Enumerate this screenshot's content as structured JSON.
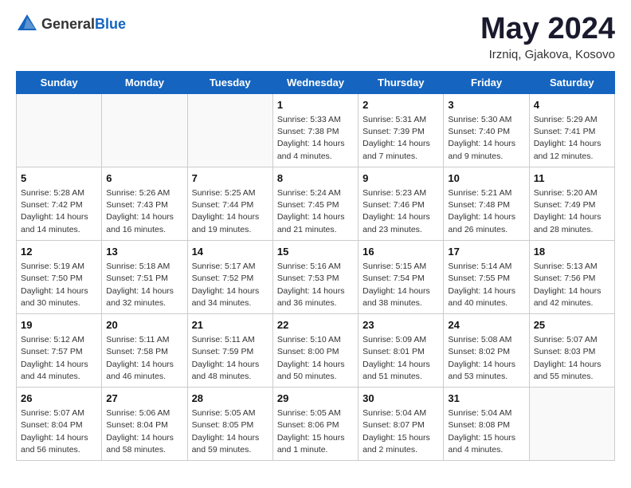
{
  "header": {
    "logo_general": "General",
    "logo_blue": "Blue",
    "month_title": "May 2024",
    "location": "Irzniq, Gjakova, Kosovo"
  },
  "weekdays": [
    "Sunday",
    "Monday",
    "Tuesday",
    "Wednesday",
    "Thursday",
    "Friday",
    "Saturday"
  ],
  "weeks": [
    [
      {
        "day": "",
        "info": ""
      },
      {
        "day": "",
        "info": ""
      },
      {
        "day": "",
        "info": ""
      },
      {
        "day": "1",
        "info": "Sunrise: 5:33 AM\nSunset: 7:38 PM\nDaylight: 14 hours\nand 4 minutes."
      },
      {
        "day": "2",
        "info": "Sunrise: 5:31 AM\nSunset: 7:39 PM\nDaylight: 14 hours\nand 7 minutes."
      },
      {
        "day": "3",
        "info": "Sunrise: 5:30 AM\nSunset: 7:40 PM\nDaylight: 14 hours\nand 9 minutes."
      },
      {
        "day": "4",
        "info": "Sunrise: 5:29 AM\nSunset: 7:41 PM\nDaylight: 14 hours\nand 12 minutes."
      }
    ],
    [
      {
        "day": "5",
        "info": "Sunrise: 5:28 AM\nSunset: 7:42 PM\nDaylight: 14 hours\nand 14 minutes."
      },
      {
        "day": "6",
        "info": "Sunrise: 5:26 AM\nSunset: 7:43 PM\nDaylight: 14 hours\nand 16 minutes."
      },
      {
        "day": "7",
        "info": "Sunrise: 5:25 AM\nSunset: 7:44 PM\nDaylight: 14 hours\nand 19 minutes."
      },
      {
        "day": "8",
        "info": "Sunrise: 5:24 AM\nSunset: 7:45 PM\nDaylight: 14 hours\nand 21 minutes."
      },
      {
        "day": "9",
        "info": "Sunrise: 5:23 AM\nSunset: 7:46 PM\nDaylight: 14 hours\nand 23 minutes."
      },
      {
        "day": "10",
        "info": "Sunrise: 5:21 AM\nSunset: 7:48 PM\nDaylight: 14 hours\nand 26 minutes."
      },
      {
        "day": "11",
        "info": "Sunrise: 5:20 AM\nSunset: 7:49 PM\nDaylight: 14 hours\nand 28 minutes."
      }
    ],
    [
      {
        "day": "12",
        "info": "Sunrise: 5:19 AM\nSunset: 7:50 PM\nDaylight: 14 hours\nand 30 minutes."
      },
      {
        "day": "13",
        "info": "Sunrise: 5:18 AM\nSunset: 7:51 PM\nDaylight: 14 hours\nand 32 minutes."
      },
      {
        "day": "14",
        "info": "Sunrise: 5:17 AM\nSunset: 7:52 PM\nDaylight: 14 hours\nand 34 minutes."
      },
      {
        "day": "15",
        "info": "Sunrise: 5:16 AM\nSunset: 7:53 PM\nDaylight: 14 hours\nand 36 minutes."
      },
      {
        "day": "16",
        "info": "Sunrise: 5:15 AM\nSunset: 7:54 PM\nDaylight: 14 hours\nand 38 minutes."
      },
      {
        "day": "17",
        "info": "Sunrise: 5:14 AM\nSunset: 7:55 PM\nDaylight: 14 hours\nand 40 minutes."
      },
      {
        "day": "18",
        "info": "Sunrise: 5:13 AM\nSunset: 7:56 PM\nDaylight: 14 hours\nand 42 minutes."
      }
    ],
    [
      {
        "day": "19",
        "info": "Sunrise: 5:12 AM\nSunset: 7:57 PM\nDaylight: 14 hours\nand 44 minutes."
      },
      {
        "day": "20",
        "info": "Sunrise: 5:11 AM\nSunset: 7:58 PM\nDaylight: 14 hours\nand 46 minutes."
      },
      {
        "day": "21",
        "info": "Sunrise: 5:11 AM\nSunset: 7:59 PM\nDaylight: 14 hours\nand 48 minutes."
      },
      {
        "day": "22",
        "info": "Sunrise: 5:10 AM\nSunset: 8:00 PM\nDaylight: 14 hours\nand 50 minutes."
      },
      {
        "day": "23",
        "info": "Sunrise: 5:09 AM\nSunset: 8:01 PM\nDaylight: 14 hours\nand 51 minutes."
      },
      {
        "day": "24",
        "info": "Sunrise: 5:08 AM\nSunset: 8:02 PM\nDaylight: 14 hours\nand 53 minutes."
      },
      {
        "day": "25",
        "info": "Sunrise: 5:07 AM\nSunset: 8:03 PM\nDaylight: 14 hours\nand 55 minutes."
      }
    ],
    [
      {
        "day": "26",
        "info": "Sunrise: 5:07 AM\nSunset: 8:04 PM\nDaylight: 14 hours\nand 56 minutes."
      },
      {
        "day": "27",
        "info": "Sunrise: 5:06 AM\nSunset: 8:04 PM\nDaylight: 14 hours\nand 58 minutes."
      },
      {
        "day": "28",
        "info": "Sunrise: 5:05 AM\nSunset: 8:05 PM\nDaylight: 14 hours\nand 59 minutes."
      },
      {
        "day": "29",
        "info": "Sunrise: 5:05 AM\nSunset: 8:06 PM\nDaylight: 15 hours\nand 1 minute."
      },
      {
        "day": "30",
        "info": "Sunrise: 5:04 AM\nSunset: 8:07 PM\nDaylight: 15 hours\nand 2 minutes."
      },
      {
        "day": "31",
        "info": "Sunrise: 5:04 AM\nSunset: 8:08 PM\nDaylight: 15 hours\nand 4 minutes."
      },
      {
        "day": "",
        "info": ""
      }
    ]
  ]
}
